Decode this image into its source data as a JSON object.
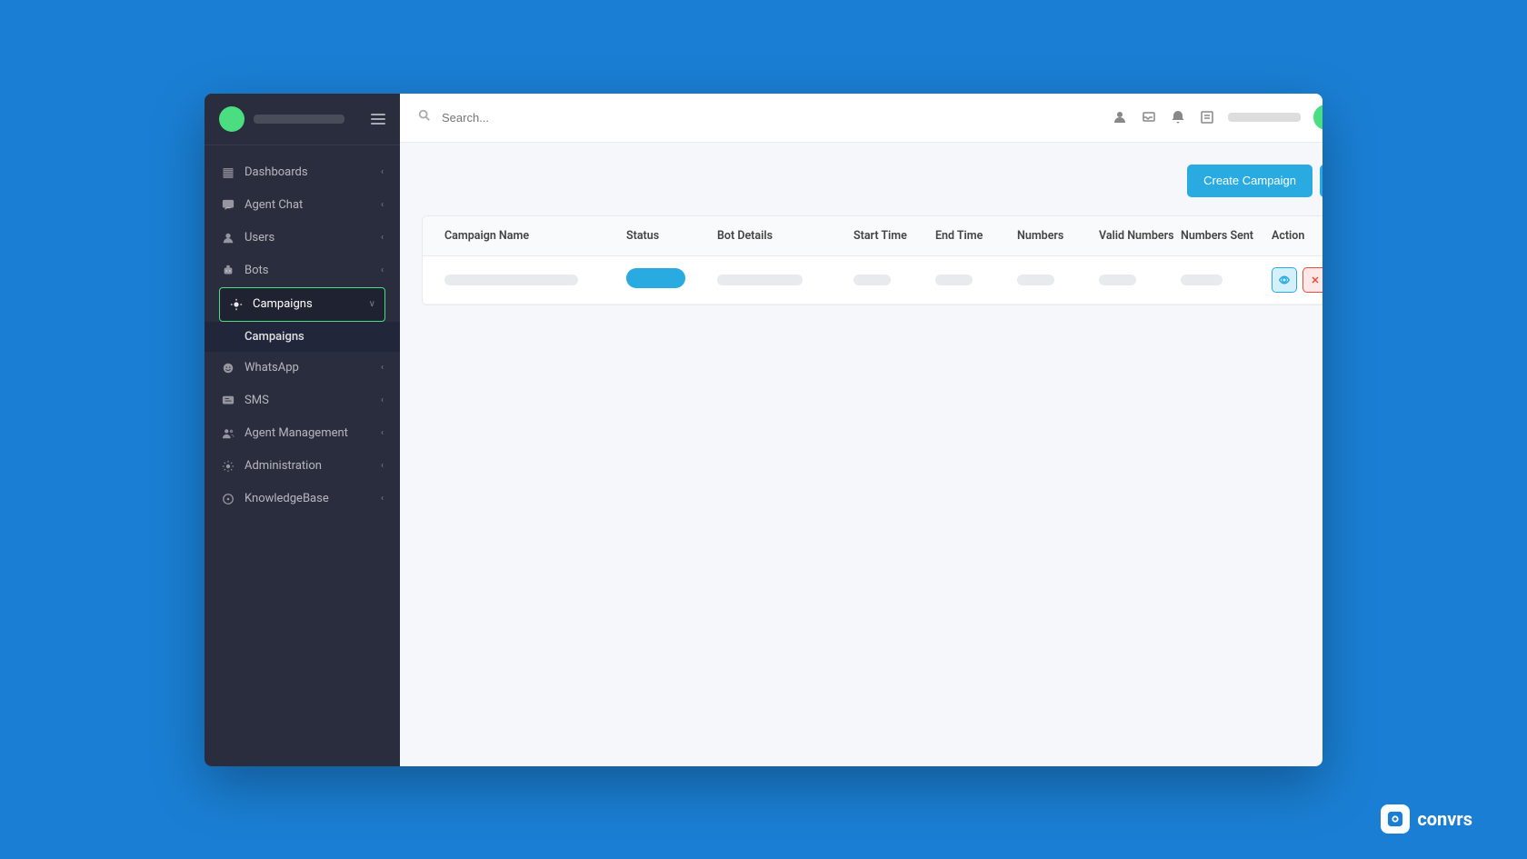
{
  "app": {
    "title": "Convrs"
  },
  "topbar": {
    "search_placeholder": "Search...",
    "user_label": ""
  },
  "sidebar": {
    "items": [
      {
        "id": "dashboards",
        "label": "Dashboards",
        "icon": "▦",
        "has_chevron": true
      },
      {
        "id": "agent-chat",
        "label": "Agent Chat",
        "icon": "💬",
        "has_chevron": true
      },
      {
        "id": "users",
        "label": "Users",
        "icon": "👤",
        "has_chevron": true
      },
      {
        "id": "bots",
        "label": "Bots",
        "icon": "🤖",
        "has_chevron": true
      },
      {
        "id": "campaigns",
        "label": "Campaigns",
        "icon": "📡",
        "has_chevron": true,
        "active": true
      },
      {
        "id": "whatsapp",
        "label": "WhatsApp",
        "icon": "💬",
        "has_chevron": true
      },
      {
        "id": "sms",
        "label": "SMS",
        "icon": "📱",
        "has_chevron": true
      },
      {
        "id": "agent-management",
        "label": "Agent Management",
        "icon": "👥",
        "has_chevron": true
      },
      {
        "id": "administration",
        "label": "Administration",
        "icon": "⚙",
        "has_chevron": true
      },
      {
        "id": "knowledgebase",
        "label": "KnowledgeBase",
        "icon": "📖",
        "has_chevron": true
      }
    ],
    "sub_items": [
      {
        "id": "campaigns-sub",
        "label": "Campaigns"
      }
    ]
  },
  "page": {
    "create_campaign_label": "Create Campaign",
    "table": {
      "columns": [
        {
          "id": "campaign-name",
          "label": "Campaign Name"
        },
        {
          "id": "status",
          "label": "Status"
        },
        {
          "id": "bot-details",
          "label": "Bot Details"
        },
        {
          "id": "start-time",
          "label": "Start Time"
        },
        {
          "id": "end-time",
          "label": "End Time"
        },
        {
          "id": "numbers",
          "label": "Numbers"
        },
        {
          "id": "valid-numbers",
          "label": "Valid Numbers"
        },
        {
          "id": "numbers-sent",
          "label": "Numbers Sent"
        },
        {
          "id": "action",
          "label": "Action"
        }
      ],
      "rows": [
        {
          "campaign_name": "",
          "status": "pill",
          "bot_details": "",
          "start_time": "",
          "end_time": "",
          "numbers": "",
          "valid_numbers": "",
          "numbers_sent": ""
        }
      ]
    }
  },
  "brand": {
    "label": "convrs"
  }
}
